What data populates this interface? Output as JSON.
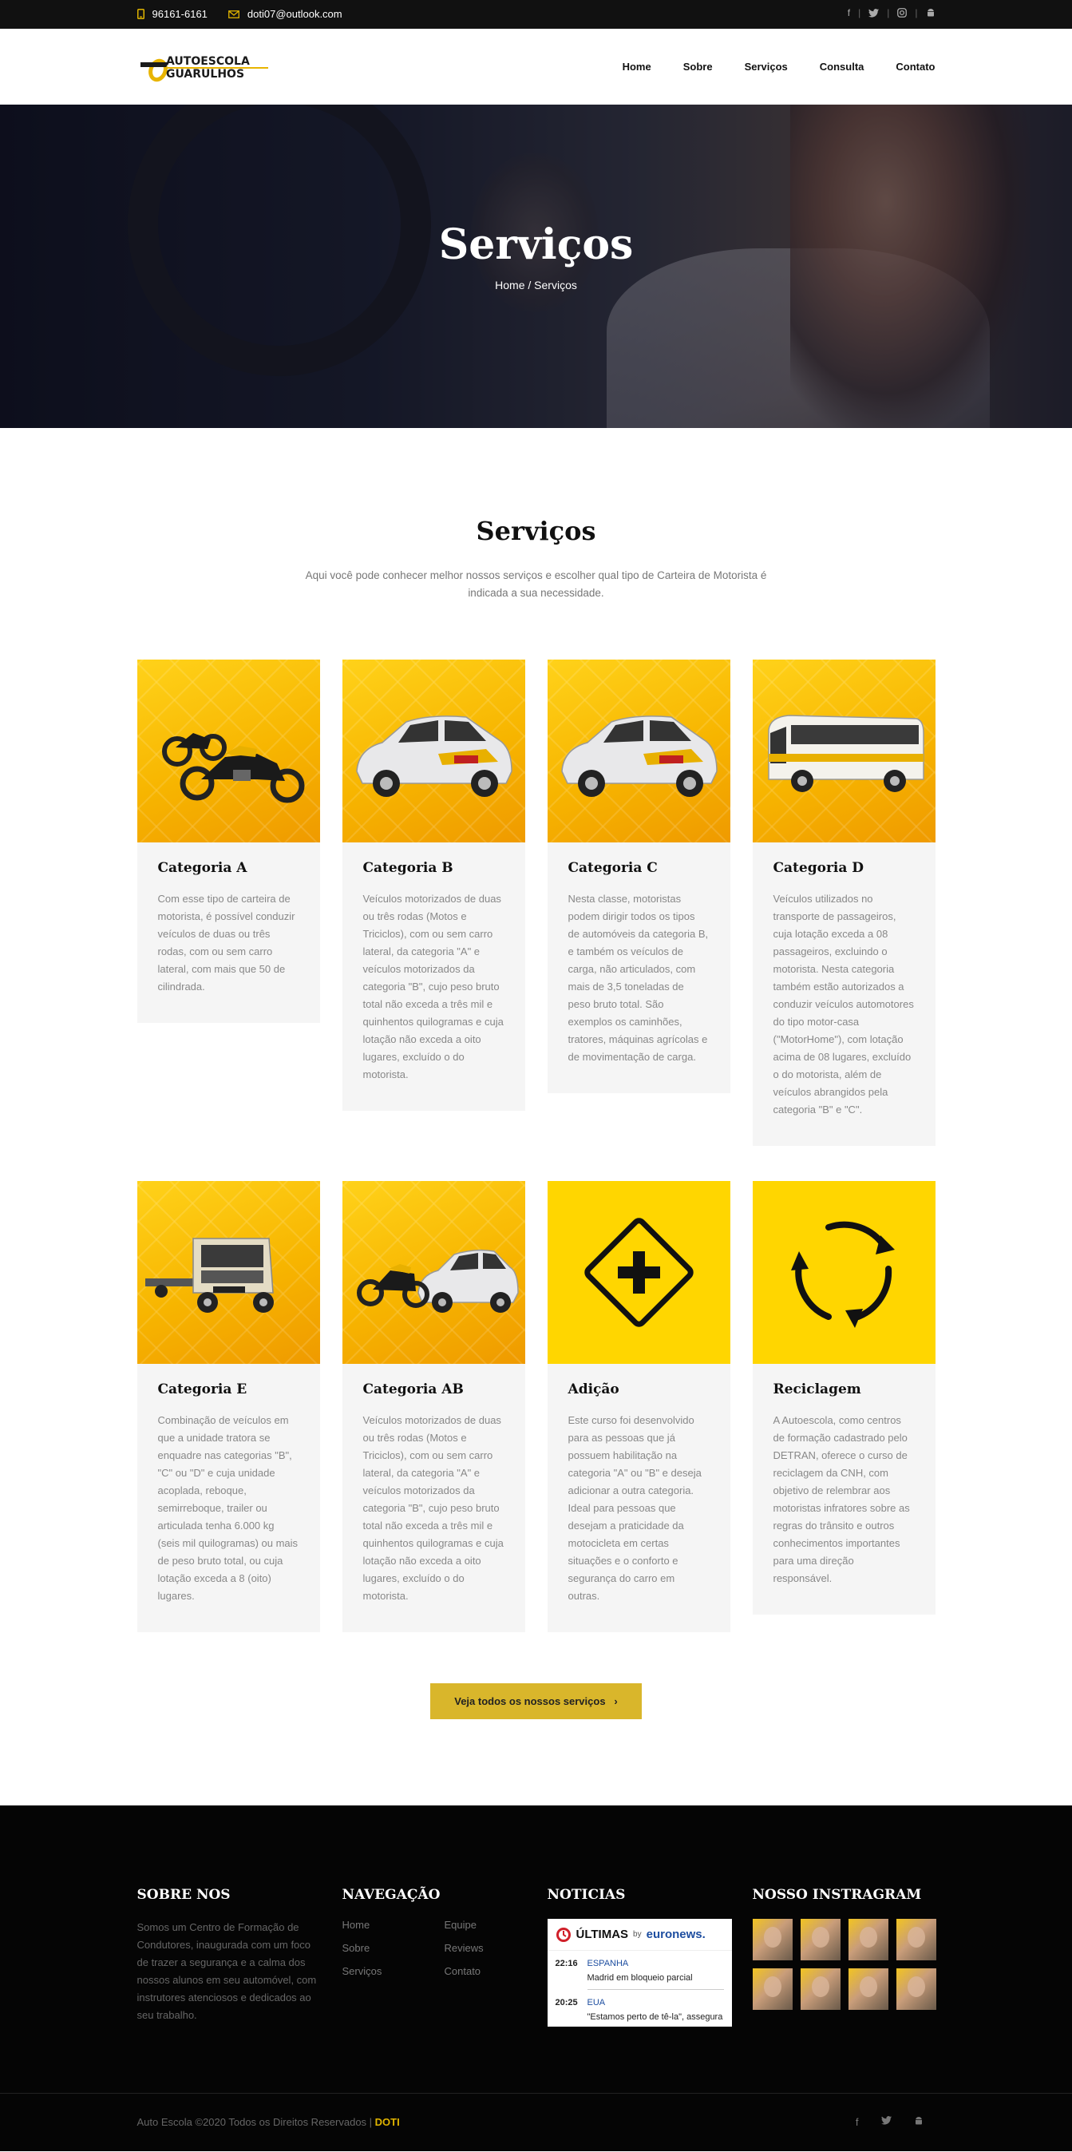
{
  "topbar": {
    "phone": "96161-6161",
    "email": "doti07@outlook.com",
    "social": [
      "facebook-icon",
      "twitter-icon",
      "instagram-icon",
      "android-icon"
    ],
    "separator": "|"
  },
  "header": {
    "logo_text_1": "AUTOESCOLA",
    "logo_text_2": "GUARULHOS",
    "nav": [
      "Home",
      "Sobre",
      "Serviços",
      "Consulta",
      "Contato"
    ]
  },
  "hero": {
    "title": "Serviços",
    "breadcrumb_home": "Home",
    "breadcrumb_sep": "/",
    "breadcrumb_current": "Serviços"
  },
  "services": {
    "title": "Serviços",
    "intro": "Aqui você pode conhecer melhor nossos serviços e escolher qual tipo de Carteira de Motorista é indicada a sua necessidade.",
    "cards": [
      {
        "title": "Categoria A",
        "icon": "motorcycle-image",
        "text": "Com esse tipo de carteira de motorista, é possível conduzir veículos de duas ou três rodas, com ou sem carro lateral, com mais que 50 de cilindrada."
      },
      {
        "title": "Categoria B",
        "icon": "car-image",
        "text": "Veículos motorizados de duas ou três rodas (Motos e Triciclos), com ou sem carro lateral, da categoria \"A\" e veículos motorizados da categoria \"B\", cujo peso bruto total não exceda a três mil e quinhentos quilogramas e cuja lotação não exceda a oito lugares, excluído o do motorista."
      },
      {
        "title": "Categoria C",
        "icon": "car-image",
        "text": "Nesta classe, motoristas podem dirigir todos os tipos de automóveis da categoria B, e também os veículos de carga, não articulados, com mais de 3,5 toneladas de peso bruto total. São exemplos os caminhões, tratores, máquinas agrícolas e de movimentação de carga."
      },
      {
        "title": "Categoria D",
        "icon": "bus-image",
        "text": "Veículos utilizados no transporte de passageiros, cuja lotação exceda a 08 passageiros, excluindo o motorista. Nesta categoria também estão autorizados a conduzir veículos automotores do tipo motor-casa (\"MotorHome\"), com lotação acima de 08 lugares, excluído o do motorista, além de veículos abrangidos pela categoria \"B\" e \"C\"."
      },
      {
        "title": "Categoria E",
        "icon": "truck-image",
        "text": "Combinação de veículos em que a unidade tratora se enquadre nas categorias \"B\", \"C\" ou \"D\" e cuja unidade acoplada, reboque, semirreboque, trailer ou articulada tenha 6.000 kg (seis mil quilogramas) ou mais de peso bruto total, ou cuja lotação exceda a 8 (oito) lugares."
      },
      {
        "title": "Categoria AB",
        "icon": "motorcycle-car-image",
        "text": "Veículos motorizados de duas ou três rodas (Motos e Triciclos), com ou sem carro lateral, da categoria \"A\" e veículos motorizados da categoria \"B\", cujo peso bruto total não exceda a três mil e quinhentos quilogramas e cuja lotação não exceda a oito lugares, excluído o do motorista."
      },
      {
        "title": "Adição",
        "icon": "plus-sign-icon",
        "text": "Este curso foi desenvolvido para as pessoas que já possuem habilitação na categoria \"A\" ou \"B\" e deseja adicionar a outra categoria. Ideal para pessoas que desejam a praticidade da motocicleta em certas situações e o conforto e segurança do carro em outras."
      },
      {
        "title": "Reciclagem",
        "icon": "recycle-icon",
        "text": "A Autoescola, como centros de formação cadastrado pelo DETRAN, oferece o curso de reciclagem da CNH, com objetivo de relembrar aos motoristas infratores sobre as regras do trânsito e outros conhecimentos importantes para uma direção responsável."
      }
    ],
    "cta": "Veja todos os nossos serviços"
  },
  "footer": {
    "about_title": "SOBRE NOS",
    "about_text": "Somos um Centro de Formação de Condutores, inaugurada com um foco de trazer a segurança e a calma dos nossos alunos em seu automóvel, com instrutores atenciosos e dedicados ao seu trabalho.",
    "nav_title": "NAVEGAÇÃO",
    "nav_links": [
      "Home",
      "Equipe",
      "Sobre",
      "Reviews",
      "Serviços",
      "Contato"
    ],
    "news_title": "NOTICIAS",
    "news": {
      "header_label": "ÚLTIMAS",
      "by": "by",
      "brand": "euronews.",
      "items": [
        {
          "time": "22:16",
          "country": "ESPANHA",
          "headline": "Madrid em bloqueio parcial"
        },
        {
          "time": "20:25",
          "country": "EUA",
          "headline": "\"Estamos perto de tê-la\", assegura"
        }
      ]
    },
    "insta_title": "NOSSO INSTRAGRAM",
    "copyright": "Auto Escola ©2020 Todos os Direitos Reservados | ",
    "copyright_brand": "DOTI",
    "bottom_social": [
      "facebook-icon",
      "twitter-icon",
      "android-icon"
    ]
  }
}
